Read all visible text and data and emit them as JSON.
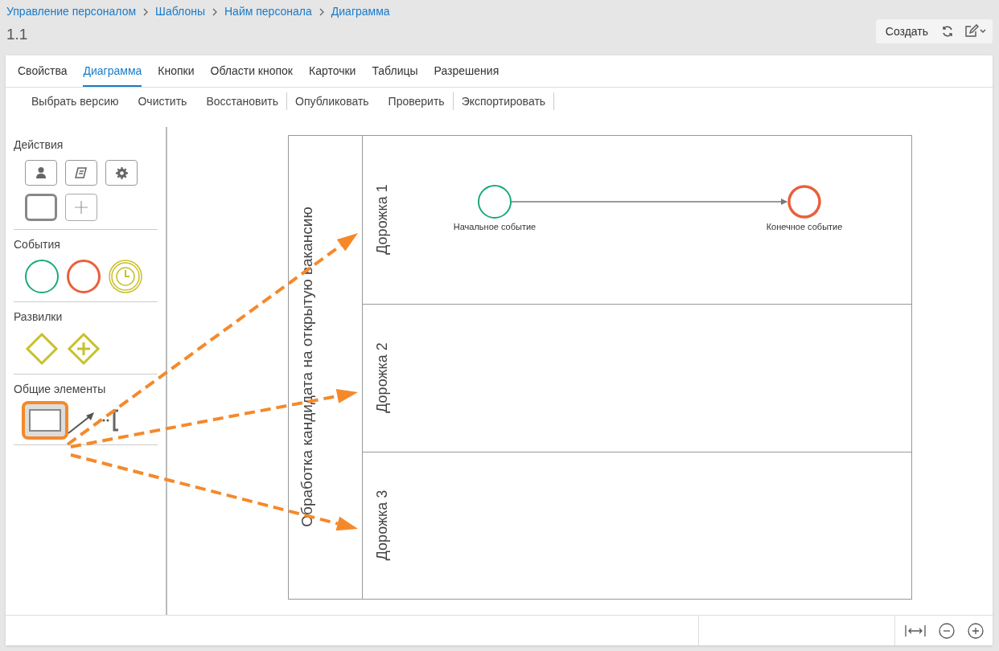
{
  "breadcrumbs": [
    "Управление персоналом",
    "Шаблоны",
    "Найм персонала",
    "Диаграмма"
  ],
  "title": "1.1",
  "header_actions": {
    "create_button": "Создать"
  },
  "tabs": [
    {
      "label": "Свойства",
      "selected": false
    },
    {
      "label": "Диаграмма",
      "selected": true
    },
    {
      "label": "Кнопки",
      "selected": false
    },
    {
      "label": "Области кнопок",
      "selected": false
    },
    {
      "label": "Карточки",
      "selected": false
    },
    {
      "label": "Таблицы",
      "selected": false
    },
    {
      "label": "Разрешения",
      "selected": false
    }
  ],
  "toolbar": [
    [
      "Выбрать версию",
      "Очистить",
      "Восстановить"
    ],
    [
      "Опубликовать",
      "Проверить"
    ],
    [
      "Экспортировать"
    ]
  ],
  "palette": [
    {
      "title": "Действия",
      "items": [
        {
          "kind": "user-task",
          "highlighted": false
        },
        {
          "kind": "script-task",
          "highlighted": false
        },
        {
          "kind": "service-task",
          "highlighted": false
        },
        {
          "kind": "task",
          "highlighted": false
        },
        {
          "kind": "add",
          "highlighted": false
        }
      ]
    },
    {
      "title": "События",
      "items": [
        {
          "kind": "start-event",
          "highlighted": false
        },
        {
          "kind": "end-event",
          "highlighted": false
        },
        {
          "kind": "timer-event",
          "highlighted": false
        }
      ]
    },
    {
      "title": "Развилки",
      "items": [
        {
          "kind": "exclusive-gateway",
          "highlighted": false
        },
        {
          "kind": "parallel-gateway",
          "highlighted": false
        }
      ]
    },
    {
      "title": "Общие элементы",
      "items": [
        {
          "kind": "lane",
          "highlighted": true
        },
        {
          "kind": "connection",
          "highlighted": false
        },
        {
          "kind": "annotation",
          "highlighted": false
        }
      ]
    }
  ],
  "diagram": {
    "pool_label": "Обработка кандидата на открытую вакансию",
    "lanes": [
      {
        "label": "Дорожка 1",
        "elements": [
          {
            "kind": "start-event",
            "label": "Начальное событие"
          },
          {
            "kind": "end-event",
            "label": "Конечное событие"
          }
        ]
      },
      {
        "label": "Дорожка 2"
      },
      {
        "label": "Дорожка 3"
      }
    ]
  }
}
